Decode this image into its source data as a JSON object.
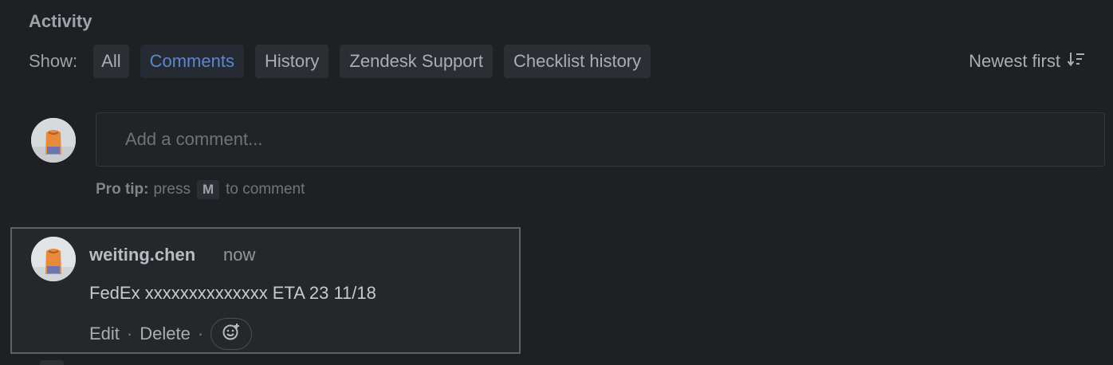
{
  "activity": {
    "heading": "Activity",
    "show_label": "Show:",
    "filters": [
      {
        "label": "All",
        "active": false
      },
      {
        "label": "Comments",
        "active": true
      },
      {
        "label": "History",
        "active": false
      },
      {
        "label": "Zendesk Support",
        "active": false
      },
      {
        "label": "Checklist history",
        "active": false
      }
    ],
    "sort_label": "Newest first",
    "sort_icon": "sort-descending-icon"
  },
  "composer": {
    "placeholder": "Add a comment...",
    "protip_label": "Pro tip:",
    "protip_pre": "press",
    "protip_key": "M",
    "protip_post": "to comment"
  },
  "comment": {
    "author": "weiting.chen",
    "time": "now",
    "body": "FedEx xxxxxxxxxxxxxx ETA 23 11/18",
    "edit_label": "Edit",
    "separator": "·",
    "delete_label": "Delete",
    "reaction_icon": "add-reaction-icon"
  },
  "colors": {
    "background": "#1f2023",
    "active_filter": "#5c87cf",
    "card_border": "#5d6067"
  }
}
